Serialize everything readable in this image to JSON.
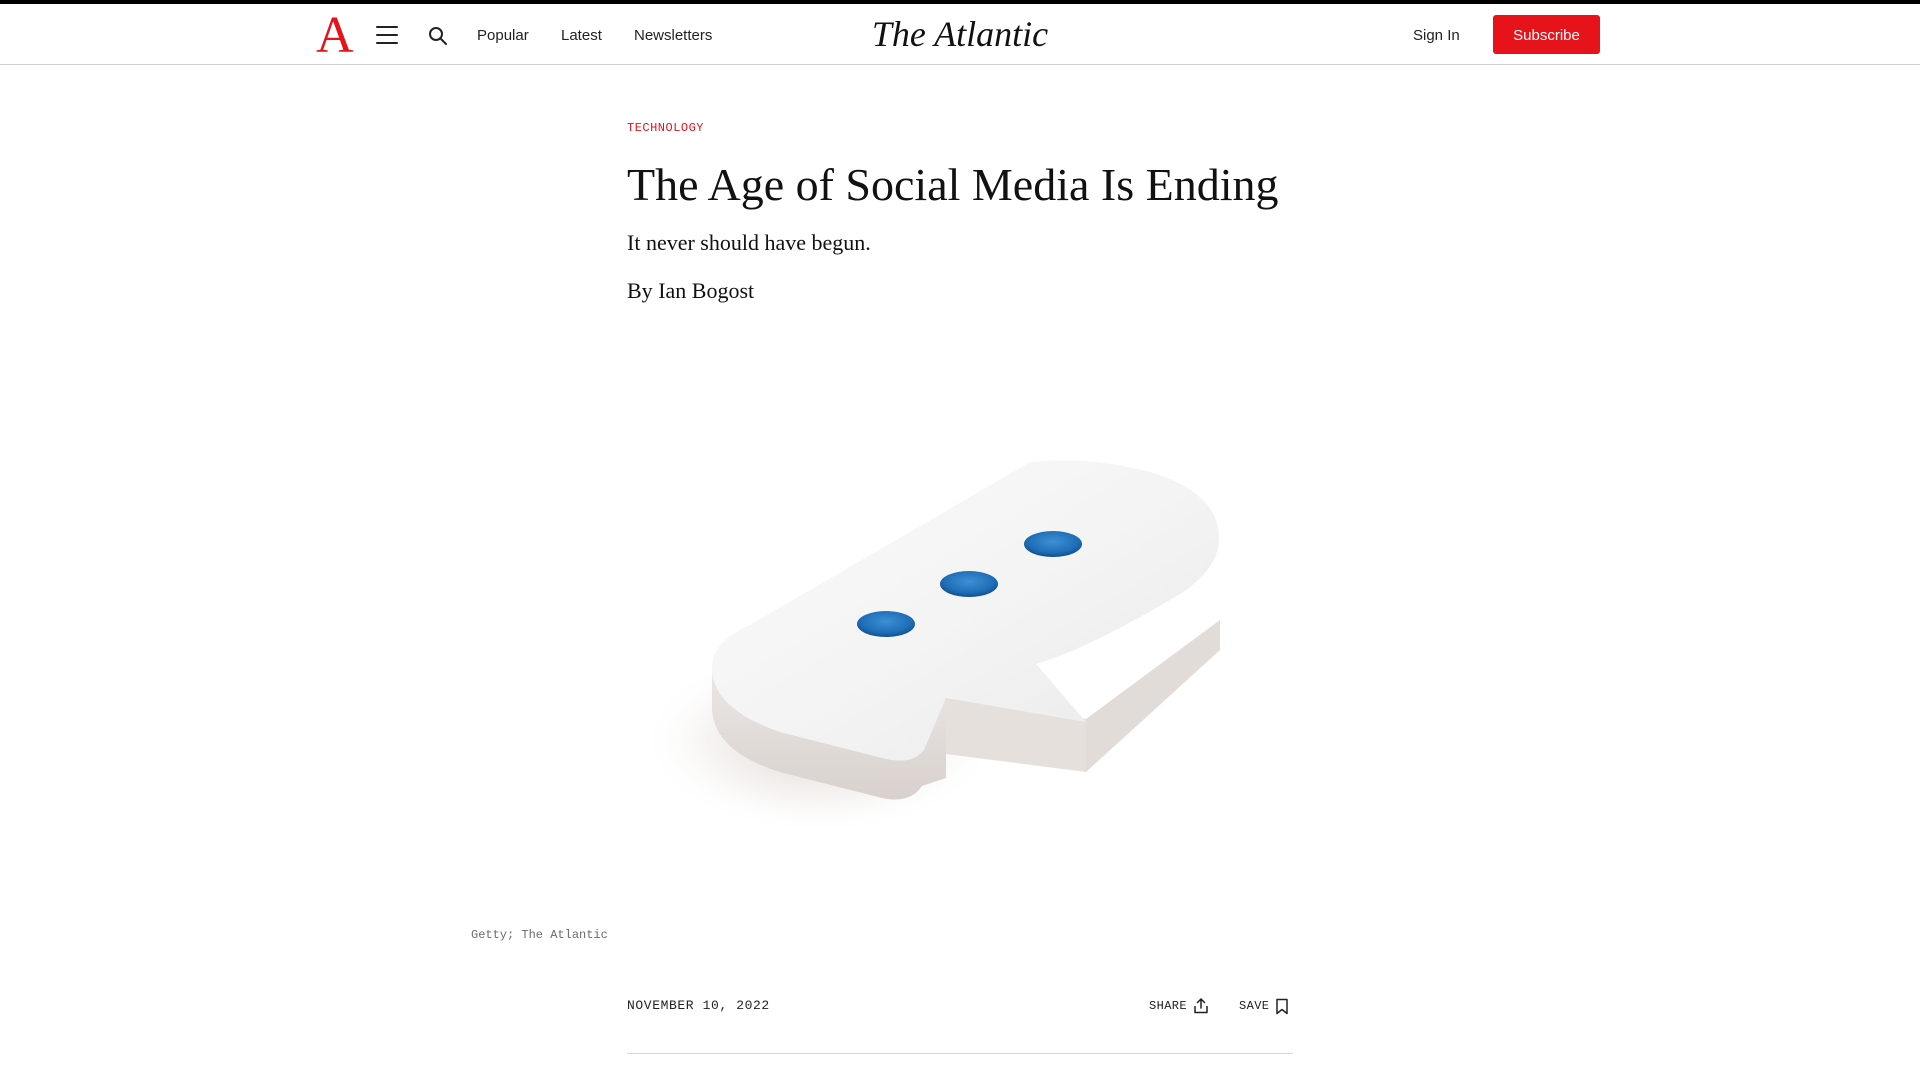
{
  "header": {
    "logo_letter": "A",
    "nav": {
      "popular": "Popular",
      "latest": "Latest",
      "newsletters": "Newsletters"
    },
    "wordmark": "The Atlantic",
    "sign_in": "Sign In",
    "subscribe": "Subscribe",
    "icons": {
      "menu": "menu-icon",
      "search": "search-icon"
    }
  },
  "article": {
    "section": "TECHNOLOGY",
    "headline": "The Age of Social Media Is Ending",
    "dek": "It never should have begun.",
    "byline_prefix": "By",
    "author": "Ian Bogost",
    "image_credit": "Getty; The Atlantic",
    "date": "NOVEMBER 10, 2022",
    "share_label": "SHARE",
    "save_label": "SAVE",
    "icons": {
      "share": "share-icon",
      "save": "bookmark-icon"
    }
  },
  "colors": {
    "brand_red": "#e7131a",
    "text": "#111111",
    "bubble_dot_blue": "#1f6fb8"
  }
}
